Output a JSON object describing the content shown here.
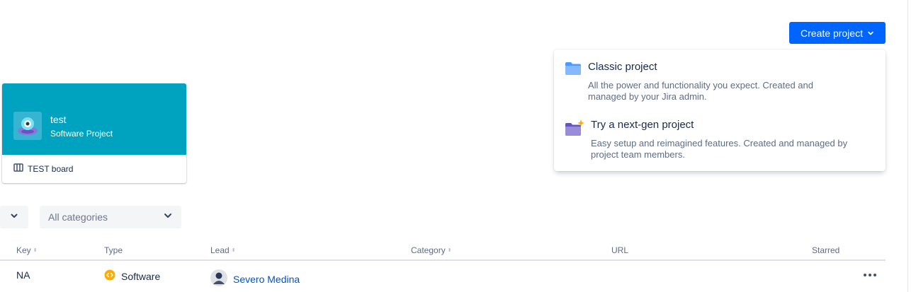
{
  "header": {
    "create_button_label": "Create project"
  },
  "create_menu": {
    "items": [
      {
        "title": "Classic project",
        "description_line1": "All the power and functionality you expect. Created and",
        "description_line2": "managed by your Jira admin.",
        "icon": "folder-icon"
      },
      {
        "title": "Try a next-gen project",
        "description_line1": "Easy setup and reimagined features. Created and managed by",
        "description_line2": "project team members.",
        "icon": "sparkle-folder-icon"
      }
    ]
  },
  "project_card": {
    "name": "test",
    "type": "Software Project",
    "board_link": "TEST board",
    "header_color": "#00a3bf"
  },
  "filters": {
    "category_placeholder": "All categories"
  },
  "table": {
    "headers": {
      "key": "Key",
      "type": "Type",
      "lead": "Lead",
      "category": "Category",
      "url": "URL",
      "starred": "Starred"
    },
    "rows": [
      {
        "key": "NA",
        "type": "Software",
        "lead": "Severo Medina",
        "category": "",
        "url": ""
      }
    ]
  },
  "colors": {
    "primary": "#0065ff",
    "link": "#0052cc",
    "text": "#172b4d",
    "subtle_text": "#5e6c84"
  }
}
